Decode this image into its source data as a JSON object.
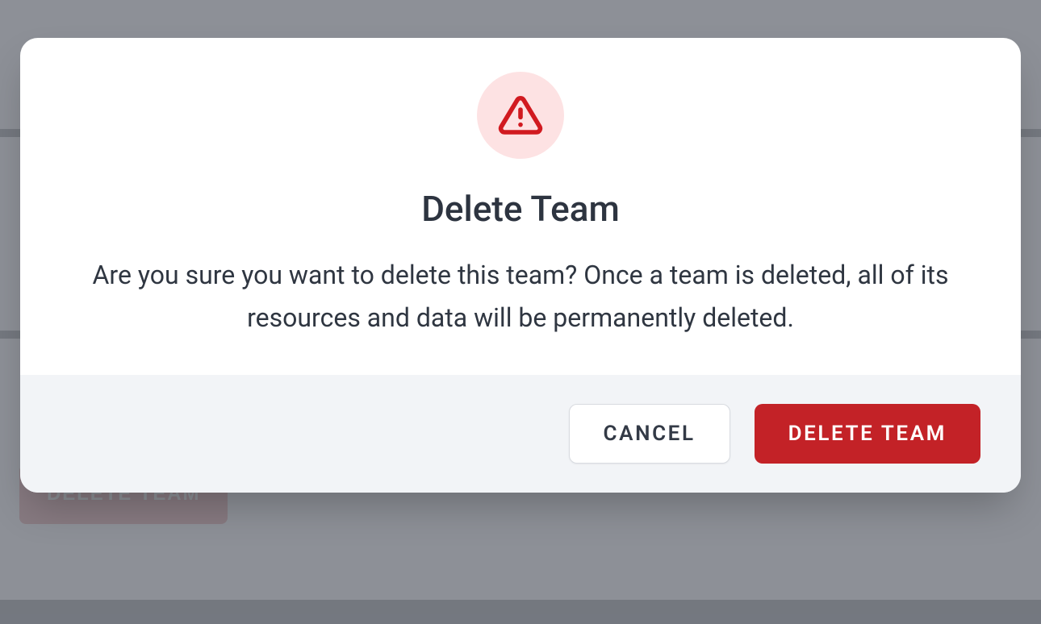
{
  "background": {
    "delete_button_label": "DELETE TEAM"
  },
  "modal": {
    "icon": "warning",
    "title": "Delete Team",
    "message": "Are you sure you want to delete this team? Once a team is deleted, all of its resources and data will be permanently deleted.",
    "cancel_label": "CANCEL",
    "confirm_label": "DELETE TEAM"
  },
  "colors": {
    "danger": "#c32227",
    "danger_bg": "#fde2e3",
    "footer_bg": "#f2f4f7",
    "text": "#2d3440"
  }
}
